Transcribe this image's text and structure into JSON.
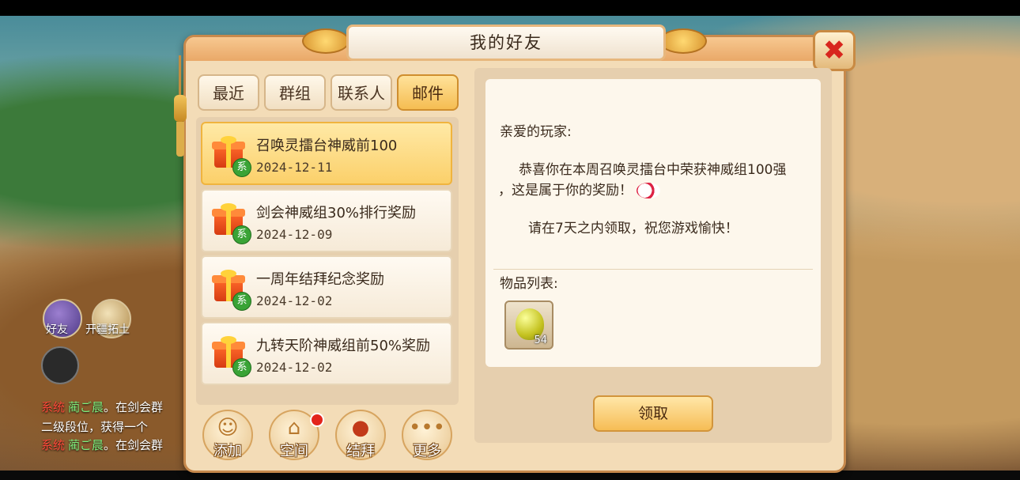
{
  "window": {
    "title": "我的好友",
    "close_glyph": "✖"
  },
  "tabs": [
    {
      "label": "最近",
      "active": false
    },
    {
      "label": "群组",
      "active": false
    },
    {
      "label": "联系人",
      "active": false
    },
    {
      "label": "邮件",
      "active": true
    }
  ],
  "mails": [
    {
      "title": "召唤灵擂台神威前100",
      "date": "2024-12-11",
      "badge": "系",
      "selected": true
    },
    {
      "title": "剑会神威组30%排行奖励",
      "date": "2024-12-09",
      "badge": "系",
      "selected": false
    },
    {
      "title": "一周年结拜纪念奖励",
      "date": "2024-12-02",
      "badge": "系",
      "selected": false
    },
    {
      "title": "九转天阶神威组前50%奖励",
      "date": "2024-12-02",
      "badge": "系",
      "selected": false
    }
  ],
  "bottom_actions": [
    {
      "label": "添加",
      "icon": "add-friend-icon"
    },
    {
      "label": "空间",
      "icon": "house-icon"
    },
    {
      "label": "结拜",
      "icon": "jar-icon"
    },
    {
      "label": "更多",
      "icon": "more-dots-icon"
    }
  ],
  "letter": {
    "greeting": "亲爱的玩家:",
    "body_line1": "恭喜你在本周召唤灵擂台中荣获神威组100强",
    "body_line2": "，这是属于你的奖励！",
    "body_line3": "请在7天之内领取，祝您游戏愉快！",
    "items_label": "物品列表:",
    "item": {
      "name": "bean-icon",
      "quantity": "54"
    },
    "claim_label": "领取"
  },
  "background": {
    "side_labels": [
      "好友",
      "开疆拓土"
    ],
    "chat": [
      {
        "tag": "系统",
        "name": "蔺ご晨",
        "text": "。在剑会群"
      },
      {
        "tag": "",
        "name": "",
        "text": "二级段位，获得一个"
      },
      {
        "tag": "系统",
        "name": "蔺ご晨",
        "text": "。在剑会群"
      }
    ]
  },
  "colors": {
    "accent": "#f5bd52",
    "close_red": "#d8261e",
    "badge_green": "#3aa336"
  }
}
